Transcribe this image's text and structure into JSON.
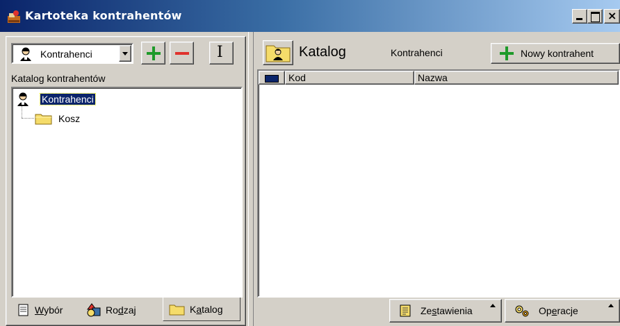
{
  "window": {
    "title": "Kartoteka kontrahentów"
  },
  "left": {
    "combo_value": "Kontrahenci",
    "section_label": "Katalog kontrahentów",
    "tree": {
      "root_label": "Kontrahenci",
      "children": [
        "Kosz"
      ]
    },
    "tabs": [
      {
        "label_pre": "",
        "label_u": "W",
        "label_post": "ybór"
      },
      {
        "label_pre": "Ro",
        "label_u": "d",
        "label_post": "zaj"
      },
      {
        "label_pre": "K",
        "label_u": "a",
        "label_post": "talog"
      }
    ]
  },
  "right": {
    "title": "Katalog",
    "subtitle": "Kontrahenci",
    "new_button": "Nowy kontrahent",
    "columns": [
      "Kod",
      "Nazwa"
    ],
    "rows": [],
    "bottom_buttons": [
      {
        "label_pre": "Ze",
        "label_u": "s",
        "label_post": "tawienia"
      },
      {
        "label_pre": "Op",
        "label_u": "e",
        "label_post": "racje"
      }
    ]
  },
  "colors": {
    "titlebar_start": "#0a246a",
    "titlebar_end": "#a6caf0",
    "selection": "#0a246a",
    "add_green": "#1e9a2a",
    "remove_red": "#e0322d"
  }
}
